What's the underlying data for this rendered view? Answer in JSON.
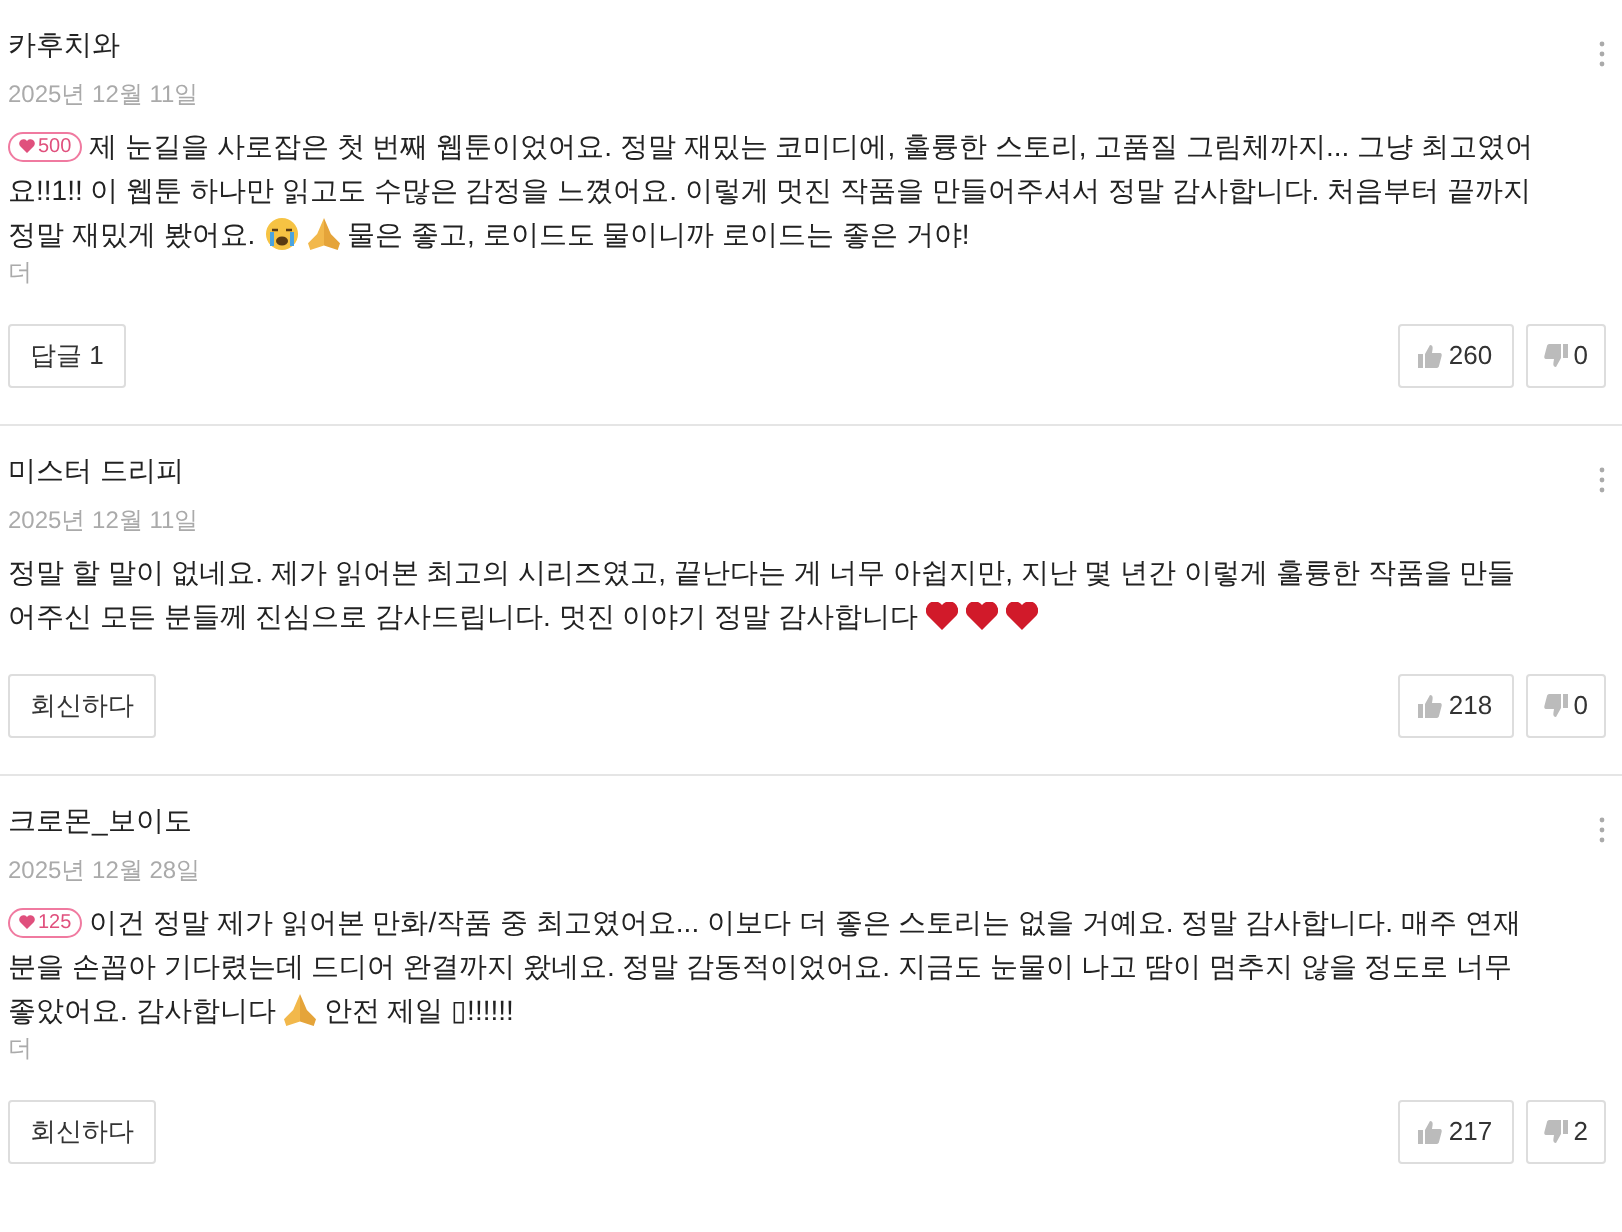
{
  "comments": [
    {
      "author": "카후치와",
      "date": "2025년 12월 11일",
      "badge": "500",
      "lines": [
        [
          {
            "kind": "text",
            "text": "제 눈길을 사로잡은 첫 번째 웹툰이었어요. 정말 재밌는 코미디에, 훌륭한 스토리, 고품질 그림체까지... 그냥 최고였어"
          }
        ],
        [
          {
            "kind": "text",
            "text": "요!!1!! 이 웹툰 하나만 읽고도 수많은 감정을 느꼈어요. 이렇게 멋진 작품을 만들어주셔서 정말 감사합니다. 처음부터 끝까지"
          }
        ],
        [
          {
            "kind": "text",
            "text": "정말 재밌게 봤어요."
          },
          {
            "kind": "crying-face"
          },
          {
            "kind": "praying-hands"
          },
          {
            "kind": "text",
            "text": "물은 좋고, 로이드도 물이니까 로이드는 좋은 거야!"
          }
        ]
      ],
      "more": "더",
      "reply": "답글 1",
      "likes": "260",
      "dislikes": "0"
    },
    {
      "author": "미스터 드리피",
      "date": "2025년 12월 11일",
      "lines": [
        [
          {
            "kind": "text",
            "text": "정말 할 말이 없네요. 제가 읽어본 최고의 시리즈였고, 끝난다는 게 너무 아쉽지만, 지난 몇 년간 이렇게 훌륭한 작품을 만들"
          }
        ],
        [
          {
            "kind": "text",
            "text": "어주신 모든 분들께 진심으로 감사드립니다. 멋진 이야기 정말 감사합니다"
          },
          {
            "kind": "heart"
          },
          {
            "kind": "heart"
          },
          {
            "kind": "heart"
          }
        ]
      ],
      "reply": "회신하다",
      "likes": "218",
      "dislikes": "0"
    },
    {
      "author": "크로몬_보이도",
      "date": "2025년 12월 28일",
      "badge": "125",
      "lines": [
        [
          {
            "kind": "text",
            "text": "이건 정말 제가 읽어본 만화/작품 중 최고였어요... 이보다 더 좋은 스토리는 없을 거예요. 정말 감사합니다. 매주 연재"
          }
        ],
        [
          {
            "kind": "text",
            "text": "분을 손꼽아 기다렸는데 드디어 완결까지 왔네요. 정말 감동적이었어요. 지금도 눈물이 나고 땀이 멈추지 않을 정도로 너무"
          }
        ],
        [
          {
            "kind": "text",
            "text": "좋았어요. 감사합니다"
          },
          {
            "kind": "praying-hands"
          },
          {
            "kind": "text",
            "text": "안전 제일 ▯!!!!!!"
          }
        ]
      ],
      "more": "더",
      "reply": "회신하다",
      "likes": "217",
      "dislikes": "2"
    }
  ]
}
